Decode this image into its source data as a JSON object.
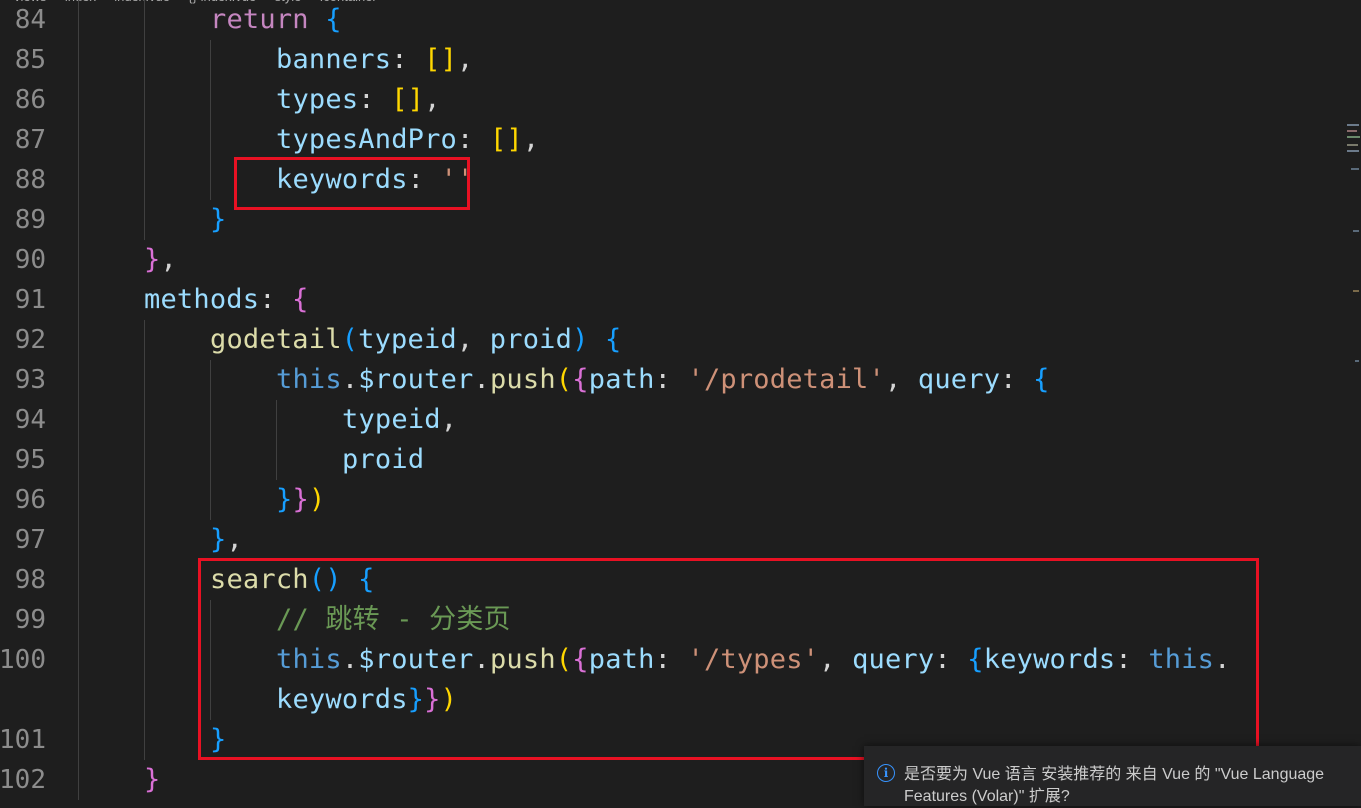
{
  "breadcrumb": [
    "views",
    "index",
    "index.vue",
    "{} index.vue",
    "style",
    ".container"
  ],
  "lines": [
    {
      "num": "84",
      "indent": 2,
      "tokens": [
        [
          "return",
          "kp"
        ],
        [
          " ",
          ""
        ],
        [
          "{",
          "b3"
        ]
      ]
    },
    {
      "num": "85",
      "indent": 3,
      "tokens": [
        [
          "banners",
          "p"
        ],
        [
          ": ",
          "w"
        ],
        [
          "[]",
          "b1"
        ],
        [
          ",",
          "w"
        ]
      ]
    },
    {
      "num": "86",
      "indent": 3,
      "tokens": [
        [
          "types",
          "p"
        ],
        [
          ": ",
          "w"
        ],
        [
          "[]",
          "b1"
        ],
        [
          ",",
          "w"
        ]
      ]
    },
    {
      "num": "87",
      "indent": 3,
      "tokens": [
        [
          "typesAndPro",
          "p"
        ],
        [
          ": ",
          "w"
        ],
        [
          "[]",
          "b1"
        ],
        [
          ",",
          "w"
        ]
      ]
    },
    {
      "num": "88",
      "indent": 3,
      "tokens": [
        [
          "keywords",
          "p"
        ],
        [
          ": ",
          "w"
        ],
        [
          "''",
          "s"
        ]
      ]
    },
    {
      "num": "89",
      "indent": 2,
      "tokens": [
        [
          "}",
          "b3"
        ]
      ]
    },
    {
      "num": "90",
      "indent": 1,
      "tokens": [
        [
          "}",
          "b2"
        ],
        [
          ",",
          "w"
        ]
      ]
    },
    {
      "num": "91",
      "indent": 1,
      "tokens": [
        [
          "methods",
          "p"
        ],
        [
          ": ",
          "w"
        ],
        [
          "{",
          "b2"
        ]
      ]
    },
    {
      "num": "92",
      "indent": 2,
      "tokens": [
        [
          "godetail",
          "f"
        ],
        [
          "(",
          "b3"
        ],
        [
          "typeid",
          "p"
        ],
        [
          ", ",
          "w"
        ],
        [
          "proid",
          "p"
        ],
        [
          ")",
          "b3"
        ],
        [
          " ",
          ""
        ],
        [
          "{",
          "b3"
        ]
      ]
    },
    {
      "num": "93",
      "indent": 3,
      "tokens": [
        [
          "this",
          "k"
        ],
        [
          ".",
          "w"
        ],
        [
          "$router",
          "p"
        ],
        [
          ".",
          "w"
        ],
        [
          "push",
          "f"
        ],
        [
          "(",
          "b1"
        ],
        [
          "{",
          "b2"
        ],
        [
          "path",
          "p"
        ],
        [
          ": ",
          "w"
        ],
        [
          "'/prodetail'",
          "s"
        ],
        [
          ", ",
          "w"
        ],
        [
          "query",
          "p"
        ],
        [
          ": ",
          "w"
        ],
        [
          "{",
          "b3"
        ]
      ]
    },
    {
      "num": "94",
      "indent": 4,
      "tokens": [
        [
          "typeid",
          "p"
        ],
        [
          ",",
          "w"
        ]
      ]
    },
    {
      "num": "95",
      "indent": 4,
      "tokens": [
        [
          "proid",
          "p"
        ]
      ]
    },
    {
      "num": "96",
      "indent": 3,
      "tokens": [
        [
          "}",
          "b3"
        ],
        [
          "}",
          "b2"
        ],
        [
          ")",
          "b1"
        ]
      ]
    },
    {
      "num": "97",
      "indent": 2,
      "tokens": [
        [
          "}",
          "b3"
        ],
        [
          ",",
          "w"
        ]
      ]
    },
    {
      "num": "98",
      "indent": 2,
      "tokens": [
        [
          "search",
          "f"
        ],
        [
          "()",
          "b3"
        ],
        [
          " ",
          ""
        ],
        [
          "{",
          "b3"
        ]
      ]
    },
    {
      "num": "99",
      "indent": 3,
      "tokens": [
        [
          "// 跳转 - 分类页",
          "c"
        ]
      ]
    },
    {
      "num": "100",
      "indent": 3,
      "tokens": [
        [
          "this",
          "k"
        ],
        [
          ".",
          "w"
        ],
        [
          "$router",
          "p"
        ],
        [
          ".",
          "w"
        ],
        [
          "push",
          "f"
        ],
        [
          "(",
          "b1"
        ],
        [
          "{",
          "b2"
        ],
        [
          "path",
          "p"
        ],
        [
          ": ",
          "w"
        ],
        [
          "'/types'",
          "s"
        ],
        [
          ", ",
          "w"
        ],
        [
          "query",
          "p"
        ],
        [
          ": ",
          "w"
        ],
        [
          "{",
          "b3"
        ],
        [
          "keywords",
          "p"
        ],
        [
          ": ",
          "w"
        ],
        [
          "this",
          "k"
        ],
        [
          ".",
          "w"
        ]
      ]
    },
    {
      "num": "",
      "indent": 3,
      "tokens": [
        [
          "keywords",
          "p"
        ],
        [
          "}",
          "b3"
        ],
        [
          "}",
          "b2"
        ],
        [
          ")",
          "b1"
        ]
      ]
    },
    {
      "num": "101",
      "indent": 2,
      "tokens": [
        [
          "}",
          "b3"
        ]
      ]
    },
    {
      "num": "102",
      "indent": 1,
      "tokens": [
        [
          "}",
          "b2"
        ]
      ]
    }
  ],
  "notification": {
    "icon": "info-icon",
    "message": "是否要为 Vue 语言 安装推荐的 来自 Vue 的 \"Vue Language Features (Volar)\" 扩展?"
  },
  "colors": {
    "background": "#1e1e1e",
    "highlight_box": "#e81123"
  }
}
